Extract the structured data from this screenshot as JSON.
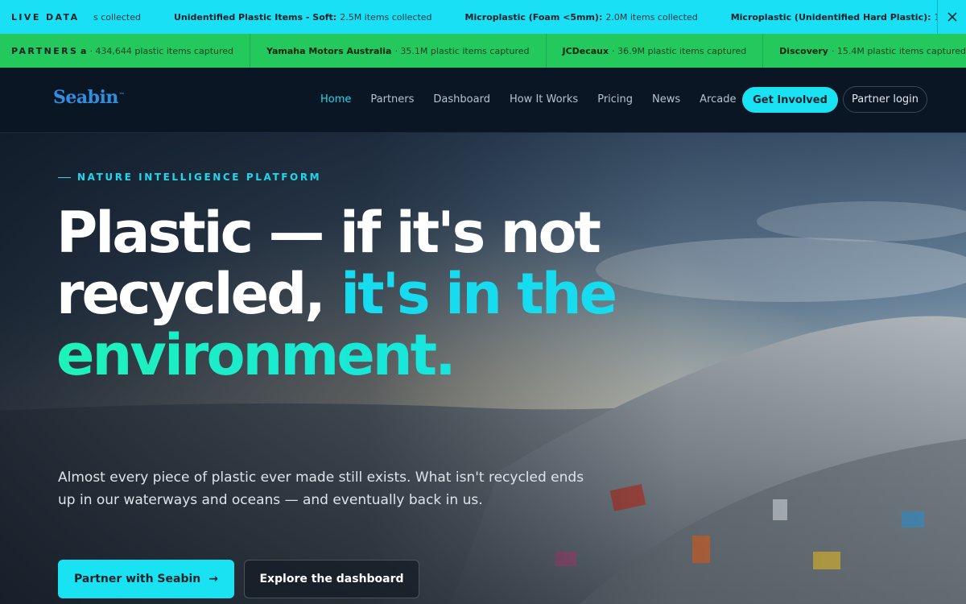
{
  "live_ticker": {
    "label": "LIVE DATA",
    "items": [
      {
        "name": "",
        "value": "s collected"
      },
      {
        "name": "Unidentified Plastic Items - Soft:",
        "value": "2.5M items collected"
      },
      {
        "name": "Microplastic (Foam <5mm):",
        "value": "2.0M items collected"
      },
      {
        "name": "Microplastic (Unidentified Hard Plastic):",
        "value": "1"
      }
    ],
    "close_icon": "close-icon"
  },
  "partners_ticker": {
    "label": "PARTNERS",
    "items": [
      {
        "name": "a",
        "value": "· 434,644 plastic items captured"
      },
      {
        "name": "Yamaha Motors Australia",
        "value": "· 35.1M plastic items captured"
      },
      {
        "name": "JCDecaux",
        "value": "· 36.9M plastic items captured"
      },
      {
        "name": "Discovery",
        "value": "· 15.4M plastic items captured"
      }
    ]
  },
  "nav": {
    "logo": "Seabin",
    "logo_mark": "™",
    "links": [
      "Home",
      "Partners",
      "Dashboard",
      "How It Works",
      "Pricing",
      "News",
      "Arcade"
    ],
    "active": "Home",
    "get_involved": "Get Involved",
    "partner_login": "Partner login"
  },
  "hero": {
    "eyebrow": "NATURE INTELLIGENCE PLATFORM",
    "headline_white": "Plastic — if it's not recycled, ",
    "headline_cyan": "it's in the",
    "headline_green": "environment.",
    "lede": "Almost every piece of plastic ever made still exists. What isn't recycled ends up in our waterways and oceans — and eventually back in us.",
    "cta_primary": "Partner with Seabin",
    "cta_primary_arrow": "→",
    "cta_secondary": "Explore the dashboard"
  },
  "colors": {
    "accent_cyan": "#19e2f2",
    "accent_green": "#24c95e",
    "nav_bg": "#0b1625"
  }
}
